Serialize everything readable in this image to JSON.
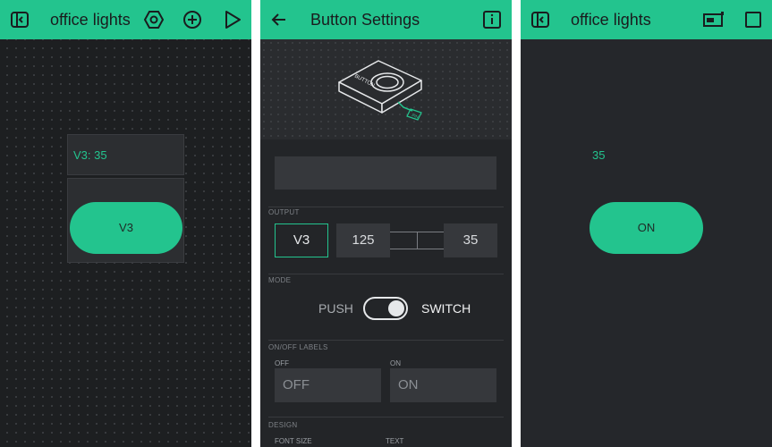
{
  "colors": {
    "accent": "#23c48e",
    "background": "#1d1f21",
    "field": "#36383c"
  },
  "screen_edit": {
    "title": "office lights",
    "icons": [
      "back-icon",
      "settings-hexagon-icon",
      "add-widget-icon",
      "play-icon"
    ],
    "display_widget": {
      "text": "V3: 35"
    },
    "button_widget": {
      "label": "V3"
    }
  },
  "screen_settings": {
    "title": "Button Settings",
    "icons": [
      "back-arrow-icon",
      "info-icon"
    ],
    "hero": {
      "device_label": "BUTTON",
      "pin_label": "PIN",
      "icon": "button-device-illustration"
    },
    "name_field": {
      "value": ""
    },
    "output": {
      "section_label": "OUTPUT",
      "pin": "V3",
      "value_from": "125",
      "value_to": "35"
    },
    "mode": {
      "section_label": "MODE",
      "left": "PUSH",
      "right": "SWITCH",
      "selected": "SWITCH"
    },
    "labels": {
      "section_label": "ON/OFF LABELS",
      "off_label": "OFF",
      "on_label": "ON",
      "off_value": "OFF",
      "on_value": "ON"
    },
    "design": {
      "section_label": "DESIGN",
      "font_size_label": "FONT SIZE",
      "text_label": "TEXT"
    }
  },
  "screen_run": {
    "title": "office lights",
    "icons": [
      "back-icon",
      "battery-icon",
      "stop-icon"
    ],
    "value": "35",
    "button_label": "ON"
  }
}
